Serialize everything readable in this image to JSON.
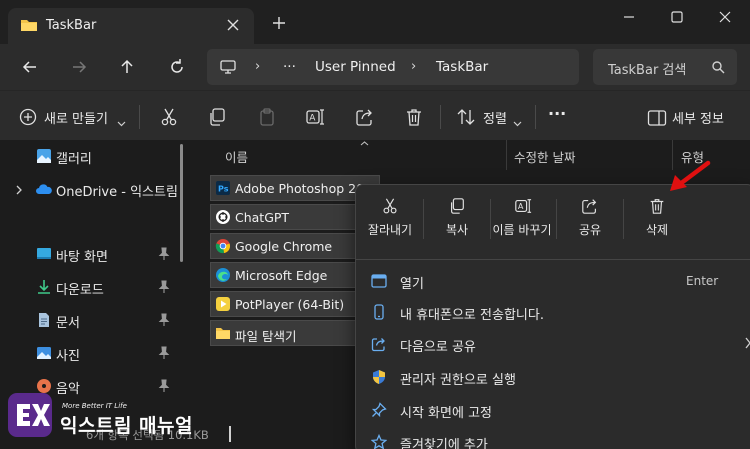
{
  "window": {
    "tab_title": "TaskBar"
  },
  "address_bar": {
    "more": "···",
    "breadcrumbs": [
      "User Pinned",
      "TaskBar"
    ],
    "search_placeholder": "TaskBar 검색"
  },
  "toolbar": {
    "new_label": "새로 만들기",
    "sort_label": "정렬",
    "more_label": "···",
    "details_label": "세부 정보"
  },
  "sidebar": {
    "items": [
      {
        "label": "갤러리",
        "icon": "gallery-icon",
        "pinned": false
      },
      {
        "label": "OneDrive - 익스트림",
        "icon": "onedrive-icon",
        "pinned": false
      },
      {
        "label": "바탕 화면",
        "icon": "desktop-icon",
        "pinned": true
      },
      {
        "label": "다운로드",
        "icon": "download-icon",
        "pinned": true
      },
      {
        "label": "문서",
        "icon": "document-icon",
        "pinned": true
      },
      {
        "label": "사진",
        "icon": "pictures-icon",
        "pinned": true
      },
      {
        "label": "음악",
        "icon": "music-icon",
        "pinned": true
      }
    ]
  },
  "file_list": {
    "columns": [
      "이름",
      "수정한 날짜",
      "유형"
    ],
    "files": [
      {
        "name": "Adobe Photoshop 202",
        "icon": "photoshop-icon"
      },
      {
        "name": "ChatGPT",
        "icon": "chatgpt-icon"
      },
      {
        "name": "Google Chrome",
        "icon": "chrome-icon"
      },
      {
        "name": "Microsoft Edge",
        "icon": "edge-icon"
      },
      {
        "name": "PotPlayer (64-Bit)",
        "icon": "potplayer-icon"
      },
      {
        "name": "파일 탐색기",
        "icon": "file-explorer-icon"
      }
    ]
  },
  "statusbar": {
    "text": "6개 항목 선택됨 10.1KB"
  },
  "context_menu": {
    "quick_actions": [
      {
        "label": "잘라내기",
        "icon": "cut-icon"
      },
      {
        "label": "복사",
        "icon": "copy-icon"
      },
      {
        "label": "이름 바꾸기",
        "icon": "rename-icon"
      },
      {
        "label": "공유",
        "icon": "share-icon"
      },
      {
        "label": "삭제",
        "icon": "delete-icon"
      }
    ],
    "items": [
      {
        "label": "열기",
        "shortcut": "Enter",
        "icon": "open-icon"
      },
      {
        "label": "내 휴대폰으로 전송합니다.",
        "icon": "phone-icon"
      },
      {
        "label": "다음으로 공유",
        "icon": "share-icon",
        "submenu": true
      },
      {
        "label": "관리자 권한으로 실행",
        "icon": "shield-icon"
      },
      {
        "label": "시작 화면에 고정",
        "icon": "pin-icon"
      },
      {
        "label": "즐겨찾기에 추가",
        "icon": "star-icon"
      }
    ]
  },
  "watermark": {
    "tagline": "More Better IT Life",
    "brand": "익스트림 매뉴얼"
  },
  "colors": {
    "accent": "#5a2a8c",
    "annotation": "#e01010"
  }
}
